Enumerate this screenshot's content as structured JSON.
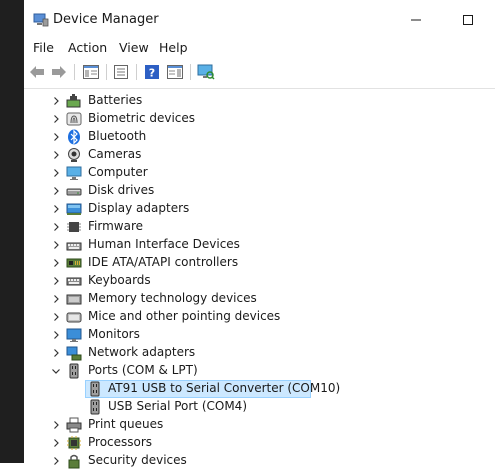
{
  "window": {
    "title": "Device Manager"
  },
  "menu": [
    "File",
    "Action",
    "View",
    "Help"
  ],
  "tree": [
    {
      "label": "Batteries",
      "icon": "battery-icon"
    },
    {
      "label": "Biometric devices",
      "icon": "fingerprint-icon"
    },
    {
      "label": "Bluetooth",
      "icon": "bluetooth-icon"
    },
    {
      "label": "Cameras",
      "icon": "camera-icon"
    },
    {
      "label": "Computer",
      "icon": "computer-icon"
    },
    {
      "label": "Disk drives",
      "icon": "disk-drive-icon"
    },
    {
      "label": "Display adapters",
      "icon": "display-adapter-icon"
    },
    {
      "label": "Firmware",
      "icon": "firmware-icon"
    },
    {
      "label": "Human Interface Devices",
      "icon": "hid-icon"
    },
    {
      "label": "IDE ATA/ATAPI controllers",
      "icon": "ide-controller-icon"
    },
    {
      "label": "Keyboards",
      "icon": "keyboard-icon"
    },
    {
      "label": "Memory technology devices",
      "icon": "memory-icon"
    },
    {
      "label": "Mice and other pointing devices",
      "icon": "mouse-icon"
    },
    {
      "label": "Monitors",
      "icon": "monitor-icon"
    },
    {
      "label": "Network adapters",
      "icon": "network-adapter-icon"
    },
    {
      "label": "Ports (COM & LPT)",
      "icon": "port-icon",
      "expanded": true,
      "children": [
        {
          "label": "AT91 USB to Serial Converter (COM10)",
          "icon": "port-icon",
          "selected": true
        },
        {
          "label": "USB Serial Port (COM4)",
          "icon": "port-icon"
        }
      ]
    },
    {
      "label": "Print queues",
      "icon": "printer-icon"
    },
    {
      "label": "Processors",
      "icon": "processor-icon"
    },
    {
      "label": "Security devices",
      "icon": "security-icon"
    }
  ],
  "colors": {
    "selection_bg": "#cce8ff",
    "selection_border": "#99d1ff"
  }
}
